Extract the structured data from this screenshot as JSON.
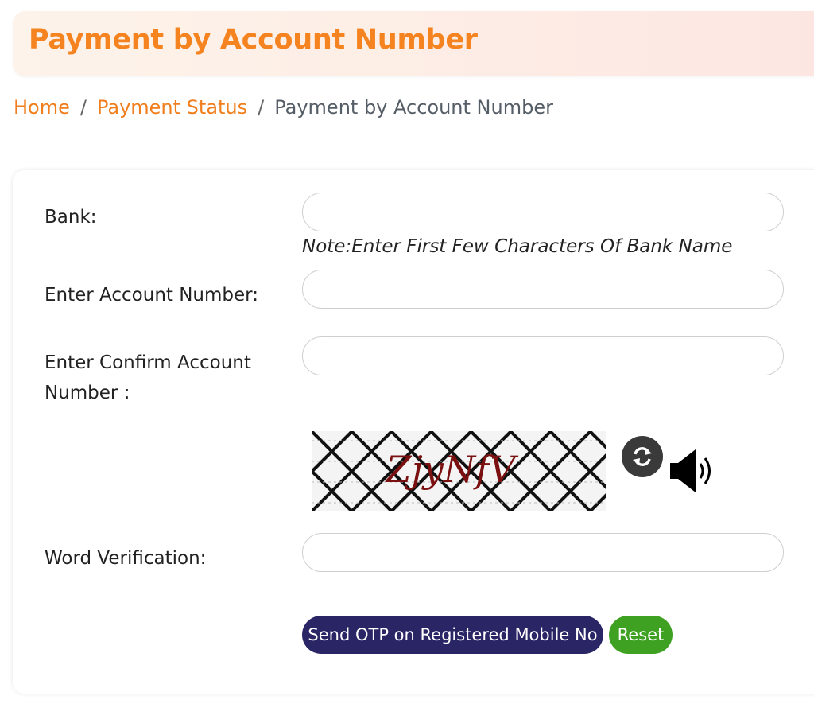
{
  "header": {
    "title": "Payment by Account Number"
  },
  "breadcrumb": {
    "items": [
      "Home",
      "Payment Status",
      "Payment by Account Number"
    ],
    "separator": "/"
  },
  "form": {
    "bank_label": "Bank:",
    "bank_value": "",
    "bank_note": "Note:Enter First Few Characters Of Bank Name",
    "account_label": "Enter Account Number:",
    "account_value": "",
    "confirm_label_line1": "Enter Confirm Account",
    "confirm_label_line2": "Number :",
    "confirm_value": "",
    "captcha_text": "ZjyNfV",
    "word_label": "Word Verification:",
    "word_value": ""
  },
  "icons": {
    "refresh": "refresh-icon",
    "audio": "speaker-icon"
  },
  "buttons": {
    "otp_label": "Send OTP on Registered Mobile No",
    "reset_label": "Reset"
  },
  "colors": {
    "title": "#f5831f",
    "link": "#f07e1c",
    "otp_button": "#2a2565",
    "reset_button": "#3ea121"
  }
}
